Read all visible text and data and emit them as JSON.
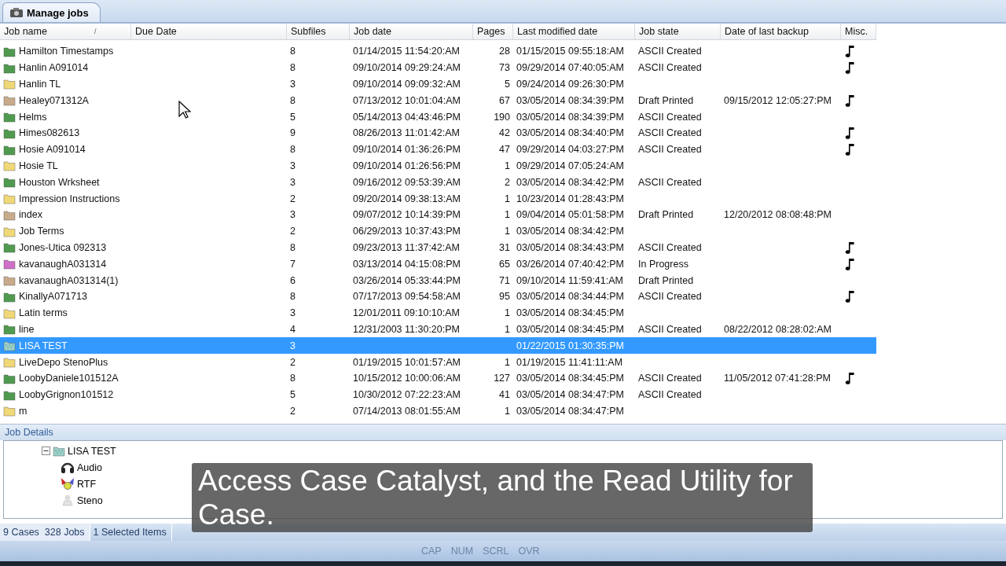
{
  "tab": {
    "label": "Manage jobs",
    "selected": true
  },
  "columns": [
    "Job name",
    "Due Date",
    "Subfiles",
    "Job date",
    "Pages",
    "Last modified date",
    "Job state",
    "Date of last backup",
    "Misc."
  ],
  "sort_indicator": "/",
  "rows": [
    {
      "name": "Hamilton Timestamps",
      "color": "#4f9a4f",
      "subfiles": "8",
      "job_date": "01/14/2015 11:54:20:AM",
      "pages": "28",
      "modified": "01/15/2015 09:55:18:AM",
      "state": "ASCII Created",
      "audio": true,
      "selected": false
    },
    {
      "name": "Hanlin A091014",
      "color": "#4f9a4f",
      "subfiles": "8",
      "job_date": "09/10/2014 09:29:24:AM",
      "pages": "73",
      "modified": "09/29/2014 07:40:05:AM",
      "state": "ASCII Created",
      "audio": true,
      "selected": false
    },
    {
      "name": "Hanlin TL",
      "color": "#f0d878",
      "subfiles": "3",
      "job_date": "09/10/2014 09:09:32:AM",
      "pages": "5",
      "modified": "09/24/2014 09:26:30:PM",
      "audio": false,
      "selected": false
    },
    {
      "name": "Healey071312A",
      "color": "#c8ab8a",
      "subfiles": "8",
      "job_date": "07/13/2012 10:01:04:AM",
      "pages": "67",
      "modified": "03/05/2014 08:34:39:PM",
      "state": "Draft Printed",
      "backup": "09/15/2012 12:05:27:PM",
      "audio": true,
      "selected": false
    },
    {
      "name": "Helms",
      "color": "#4f9a4f",
      "subfiles": "5",
      "job_date": "05/14/2013 04:43:46:PM",
      "pages": "190",
      "modified": "03/05/2014 08:34:39:PM",
      "state": "ASCII Created",
      "audio": false,
      "selected": false
    },
    {
      "name": "Himes082613",
      "color": "#4f9a4f",
      "subfiles": "9",
      "job_date": "08/26/2013 11:01:42:AM",
      "pages": "42",
      "modified": "03/05/2014 08:34:40:PM",
      "state": "ASCII Created",
      "audio": true,
      "selected": false
    },
    {
      "name": "Hosie A091014",
      "color": "#4f9a4f",
      "subfiles": "8",
      "job_date": "09/10/2014 01:36:26:PM",
      "pages": "47",
      "modified": "09/29/2014 04:03:27:PM",
      "state": "ASCII Created",
      "audio": true,
      "selected": false
    },
    {
      "name": "Hosie TL",
      "color": "#f0d878",
      "subfiles": "3",
      "job_date": "09/10/2014 01:26:56:PM",
      "pages": "1",
      "modified": "09/29/2014 07:05:24:AM",
      "audio": false,
      "selected": false
    },
    {
      "name": "Houston Wrksheet",
      "color": "#4f9a4f",
      "subfiles": "3",
      "job_date": "09/16/2012 09:53:39:AM",
      "pages": "2",
      "modified": "03/05/2014 08:34:42:PM",
      "state": "ASCII Created",
      "audio": false,
      "selected": false
    },
    {
      "name": "Impression Instructions",
      "color": "#f0d878",
      "subfiles": "2",
      "job_date": "09/20/2014 09:38:13:AM",
      "pages": "1",
      "modified": "10/23/2014 01:28:43:PM",
      "audio": false,
      "selected": false
    },
    {
      "name": "index",
      "color": "#c8ab8a",
      "subfiles": "3",
      "job_date": "09/07/2012 10:14:39:PM",
      "pages": "1",
      "modified": "09/04/2014 05:01:58:PM",
      "state": "Draft Printed",
      "backup": "12/20/2012 08:08:48:PM",
      "audio": false,
      "selected": false
    },
    {
      "name": "Job Terms",
      "color": "#f0d878",
      "subfiles": "2",
      "job_date": "06/29/2013 10:37:43:PM",
      "pages": "1",
      "modified": "03/05/2014 08:34:42:PM",
      "audio": false,
      "selected": false
    },
    {
      "name": "Jones-Utica 092313",
      "color": "#4f9a4f",
      "subfiles": "8",
      "job_date": "09/23/2013 11:37:42:AM",
      "pages": "31",
      "modified": "03/05/2014 08:34:43:PM",
      "state": "ASCII Created",
      "audio": true,
      "selected": false
    },
    {
      "name": "kavanaughA031314",
      "color": "#d070c8",
      "subfiles": "7",
      "job_date": "03/13/2014 04:15:08:PM",
      "pages": "65",
      "modified": "03/26/2014 07:40:42:PM",
      "state": "In Progress",
      "audio": true,
      "selected": false
    },
    {
      "name": "kavanaughA031314(1)",
      "color": "#c8ab8a",
      "subfiles": "6",
      "job_date": "03/26/2014 05:33:44:PM",
      "pages": "71",
      "modified": "09/10/2014 11:59:41:AM",
      "state": "Draft Printed",
      "audio": false,
      "selected": false
    },
    {
      "name": "KinallyA071713",
      "color": "#4f9a4f",
      "subfiles": "8",
      "job_date": "07/17/2013 09:54:58:AM",
      "pages": "95",
      "modified": "03/05/2014 08:34:44:PM",
      "state": "ASCII Created",
      "audio": true,
      "selected": false
    },
    {
      "name": "Latin terms",
      "color": "#f0d878",
      "subfiles": "3",
      "job_date": "12/01/2011 09:10:10:AM",
      "pages": "1",
      "modified": "03/05/2014 08:34:45:PM",
      "audio": false,
      "selected": false
    },
    {
      "name": "line",
      "color": "#4f9a4f",
      "subfiles": "4",
      "job_date": "12/31/2003 11:30:20:PM",
      "pages": "1",
      "modified": "03/05/2014 08:34:45:PM",
      "state": "ASCII Created",
      "backup": "08/22/2012 08:28:02:AM",
      "audio": false,
      "selected": false
    },
    {
      "name": "LISA TEST",
      "color": "#9ccfc8",
      "subfiles": "3",
      "modified": "01/22/2015 01:30:35:PM",
      "audio": false,
      "selected": true
    },
    {
      "name": "LiveDepo StenoPlus",
      "color": "#f0d878",
      "subfiles": "2",
      "job_date": "01/19/2015 10:01:57:AM",
      "pages": "1",
      "modified": "01/19/2015 11:41:11:AM",
      "audio": false,
      "selected": false
    },
    {
      "name": "LoobyDaniele101512A",
      "color": "#4f9a4f",
      "subfiles": "8",
      "job_date": "10/15/2012 10:00:06:AM",
      "pages": "127",
      "modified": "03/05/2014 08:34:45:PM",
      "state": "ASCII Created",
      "backup": "11/05/2012 07:41:28:PM",
      "audio": true,
      "selected": false
    },
    {
      "name": "LoobyGrignon101512",
      "color": "#4f9a4f",
      "subfiles": "5",
      "job_date": "10/30/2012 07:22:23:AM",
      "pages": "41",
      "modified": "03/05/2014 08:34:47:PM",
      "state": "ASCII Created",
      "audio": false,
      "selected": false
    },
    {
      "name": "m",
      "color": "#f0d878",
      "subfiles": "2",
      "job_date": "07/14/2013 08:01:55:AM",
      "pages": "1",
      "modified": "03/05/2014 08:34:47:PM",
      "audio": false,
      "selected": false
    }
  ],
  "job_details": {
    "title": "Job Details",
    "tree": {
      "label": "LISA TEST",
      "expanded": true,
      "children": [
        {
          "label": "Audio",
          "kind": "audio"
        },
        {
          "label": "RTF",
          "kind": "rtf"
        },
        {
          "label": "Steno",
          "kind": "steno"
        }
      ]
    }
  },
  "caption": "Access Case Catalyst, and the Read Utility for Case.",
  "status_bar": [
    "9 Cases  328 Jobs",
    "1 Selected Items"
  ],
  "indicators": [
    "CAP",
    "NUM",
    "SCRL",
    "OVR"
  ]
}
